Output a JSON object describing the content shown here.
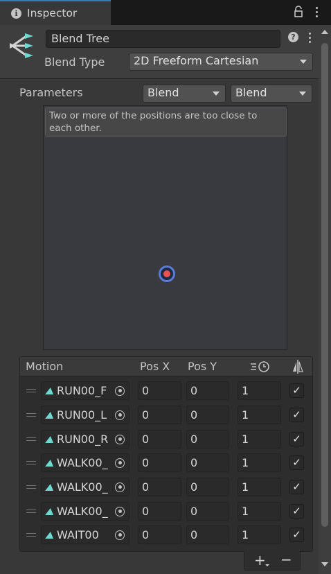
{
  "tab": {
    "title": "Inspector",
    "info_icon": "info-icon",
    "lock_icon": "lock-icon",
    "menu_icon": "kebab-menu-icon"
  },
  "header": {
    "name": "Blend Tree",
    "blend_type_label": "Blend Type",
    "blend_type_value": "2D Freeform Cartesian",
    "help_icon": "help-icon"
  },
  "parameters": {
    "label": "Parameters",
    "param_x": "Blend",
    "param_y": "Blend"
  },
  "graph": {
    "warning": "Two or more of the positions are too close to each other."
  },
  "motion_table": {
    "headers": {
      "motion": "Motion",
      "pos_x": "Pos X",
      "pos_y": "Pos Y"
    },
    "rows": [
      {
        "clip": "RUN00_F",
        "pos_x": "0",
        "pos_y": "0",
        "speed": "1",
        "mirror": "✓"
      },
      {
        "clip": "RUN00_L",
        "pos_x": "0",
        "pos_y": "0",
        "speed": "1",
        "mirror": "✓"
      },
      {
        "clip": "RUN00_R",
        "pos_x": "0",
        "pos_y": "0",
        "speed": "1",
        "mirror": "✓"
      },
      {
        "clip": "WALK00_",
        "pos_x": "0",
        "pos_y": "0",
        "speed": "1",
        "mirror": "✓"
      },
      {
        "clip": "WALK00_",
        "pos_x": "0",
        "pos_y": "0",
        "speed": "1",
        "mirror": "✓"
      },
      {
        "clip": "WALK00_",
        "pos_x": "0",
        "pos_y": "0",
        "speed": "1",
        "mirror": "✓"
      },
      {
        "clip": "WAIT00",
        "pos_x": "0",
        "pos_y": "0",
        "speed": "1",
        "mirror": "✓"
      }
    ]
  },
  "footer": {
    "add": "+",
    "remove": "−"
  },
  "colors": {
    "accent": "#3a79bb",
    "clip_icon": "#6fd8d0",
    "point": "#f05050"
  }
}
